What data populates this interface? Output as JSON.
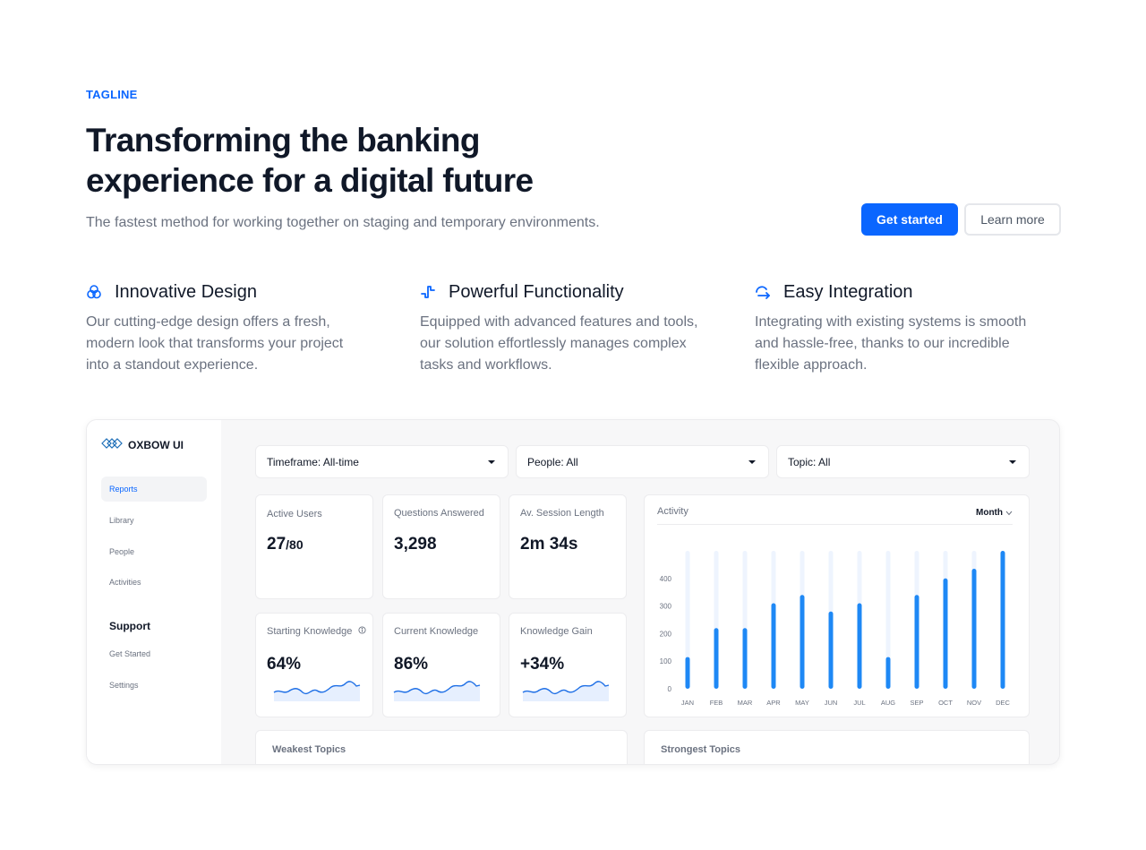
{
  "hero": {
    "tagline": "TAGLINE",
    "headline_line1": "Transforming the banking",
    "headline_line2": "experience for a digital future",
    "subline": "The fastest method for working together on staging and temporary environments.",
    "primary_button": "Get started",
    "secondary_button": "Learn more"
  },
  "features": [
    {
      "title": "Innovative Design",
      "icon": "circles-icon",
      "line1": "Our cutting-edge design offers a fresh,",
      "line2": "modern look that transforms your project",
      "line3": "into a standout experience."
    },
    {
      "title": "Powerful Functionality",
      "icon": "pulse-step-icon",
      "line1": "Equipped with advanced features and tools,",
      "line2": "our solution effortlessly manages complex",
      "line3": "tasks and workflows."
    },
    {
      "title": "Easy Integration",
      "icon": "arrow-loop-icon",
      "line1": "Integrating with existing systems is smooth",
      "line2": "and hassle-free, thanks to our incredible",
      "line3": "flexible approach."
    }
  ],
  "dashboard": {
    "brand": "OXBOW UI",
    "nav": [
      "Reports",
      "Library",
      "People",
      "Activities"
    ],
    "support_heading": "Support",
    "support_nav": [
      "Get Started",
      "Settings"
    ],
    "filters": [
      "Timeframe: All-time",
      "People: All",
      "Topic: All"
    ],
    "stats": [
      {
        "label": "Active Users",
        "value": "27",
        "suffix": "/80"
      },
      {
        "label": "Questions Answered",
        "value": "3,298"
      },
      {
        "label": "Av. Session Length",
        "value": "2m 34s"
      },
      {
        "label": "Starting Knowledge",
        "value": "64%"
      },
      {
        "label": "Current Knowledge",
        "value": "86%"
      },
      {
        "label": "Knowledge Gain",
        "value": "+34%"
      }
    ],
    "activity_title": "Activity",
    "activity_period": "Month",
    "weakest_title": "Weakest Topics",
    "strongest_title": "Strongest Topics"
  },
  "colors": {
    "accent": "#0a66ff",
    "bar": "#1e88f5",
    "bar_track": "#eef4fe"
  },
  "chart_data": {
    "type": "bar",
    "categories": [
      "JAN",
      "FEB",
      "MAR",
      "APR",
      "MAY",
      "JUN",
      "JUL",
      "AUG",
      "SEP",
      "OCT",
      "NOV",
      "DEC"
    ],
    "values": [
      115,
      220,
      220,
      310,
      340,
      280,
      310,
      115,
      340,
      400,
      435,
      500
    ],
    "y_ticks": [
      0,
      100,
      200,
      300,
      400
    ],
    "ylim": [
      0,
      500
    ],
    "title": "Activity",
    "grid": false
  }
}
